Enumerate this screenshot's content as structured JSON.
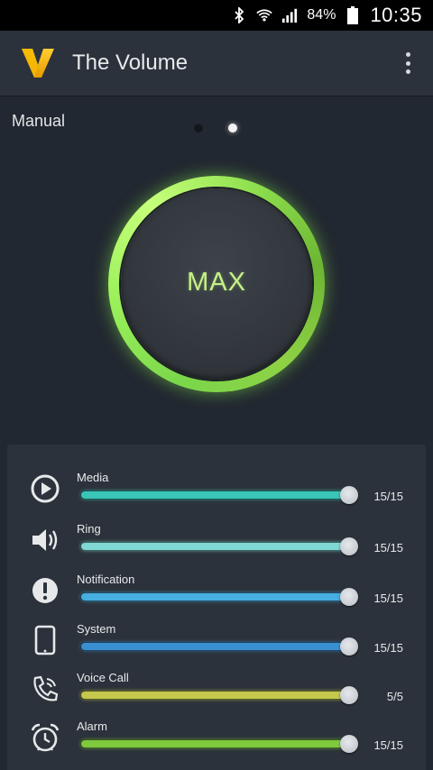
{
  "status_bar": {
    "battery_percent": "84%",
    "time": "10:35",
    "icons": [
      "bluetooth-icon",
      "wifi-icon",
      "signal-icon",
      "battery-icon"
    ]
  },
  "app_bar": {
    "title": "The Volume",
    "logo_icon": "v-logo-icon",
    "menu_icon": "more-vert-icon"
  },
  "mode_label": "Manual",
  "pager": {
    "pages": 2,
    "active_index": 1
  },
  "knob": {
    "label": "MAX",
    "accent": "#8ee04f"
  },
  "sliders": [
    {
      "id": "media",
      "label": "Media",
      "icon": "play-circle-icon",
      "value": 15,
      "max": 15,
      "display": "15/15",
      "color": "#39c6b8"
    },
    {
      "id": "ring",
      "label": "Ring",
      "icon": "speaker-icon",
      "value": 15,
      "max": 15,
      "display": "15/15",
      "color": "#7fd8d3"
    },
    {
      "id": "notification",
      "label": "Notification",
      "icon": "alert-circle-icon",
      "value": 15,
      "max": 15,
      "display": "15/15",
      "color": "#46aee0"
    },
    {
      "id": "system",
      "label": "System",
      "icon": "phone-device-icon",
      "value": 15,
      "max": 15,
      "display": "15/15",
      "color": "#3a8fd0"
    },
    {
      "id": "voice_call",
      "label": "Voice Call",
      "icon": "phone-call-icon",
      "value": 5,
      "max": 5,
      "display": "5/5",
      "color": "#c4c84c"
    },
    {
      "id": "alarm",
      "label": "Alarm",
      "icon": "alarm-clock-icon",
      "value": 15,
      "max": 15,
      "display": "15/15",
      "color": "#7ec93e"
    }
  ]
}
